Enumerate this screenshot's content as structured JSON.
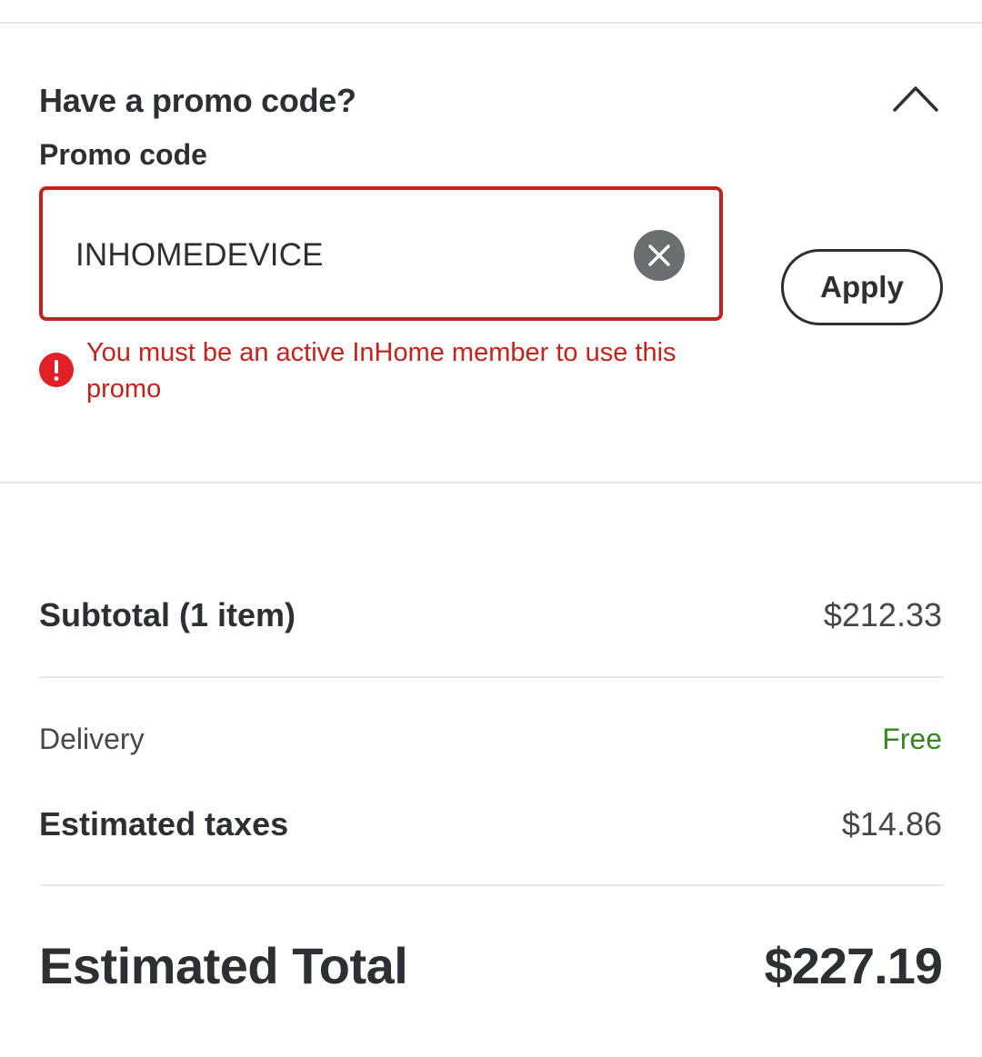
{
  "promo": {
    "title": "Have a promo code?",
    "field_label": "Promo code",
    "input_value": "INHOMEDEVICE",
    "apply_label": "Apply",
    "error_message": "You must be an active InHome member to use this promo",
    "toggle_icon": "chevron-up-icon",
    "clear_icon": "close-circle-icon",
    "error_icon": "exclamation-circle-icon"
  },
  "summary": {
    "subtotal_label": "Subtotal (1 item)",
    "subtotal_value": "$212.33",
    "delivery_label": "Delivery",
    "delivery_value": "Free",
    "taxes_label": "Estimated taxes",
    "taxes_value": "$14.86",
    "total_label": "Estimated Total",
    "total_value": "$227.19"
  },
  "colors": {
    "error": "#c1241c",
    "error_icon": "#e01f26",
    "free": "#3a8522",
    "text": "#2e2f32",
    "divider": "#e9e9ea"
  }
}
